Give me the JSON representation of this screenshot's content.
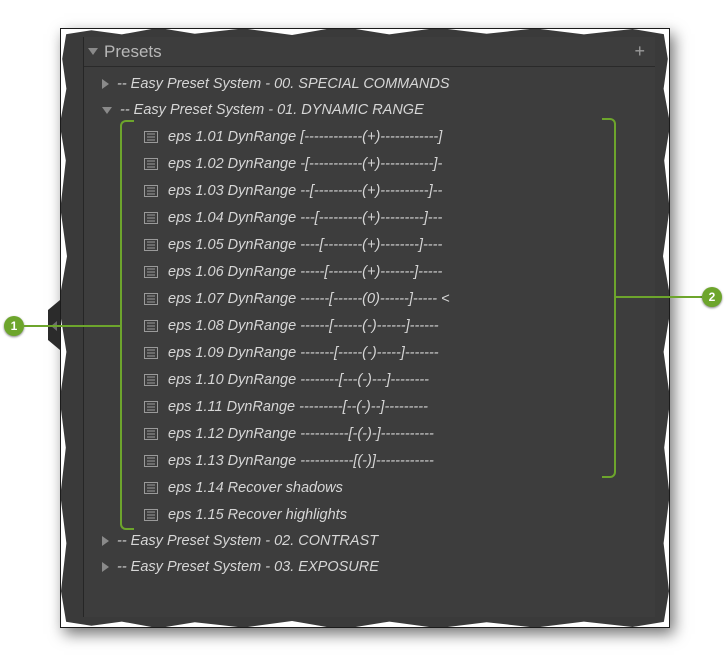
{
  "panel": {
    "title": "Presets",
    "add_label": "+"
  },
  "folders": [
    {
      "expanded": false,
      "label": "-- Easy Preset System - 00. SPECIAL COMMANDS"
    },
    {
      "expanded": true,
      "label": "-- Easy Preset System - 01. DYNAMIC RANGE"
    },
    {
      "expanded": false,
      "label": "-- Easy Preset System - 02. CONTRAST"
    },
    {
      "expanded": false,
      "label": "-- Easy Preset System - 03. EXPOSURE"
    }
  ],
  "presets_dynamic_range": [
    {
      "label": "eps 1.01 DynRange [------------(+)------------]"
    },
    {
      "label": "eps 1.02 DynRange -[-----------(+)-----------]-"
    },
    {
      "label": "eps 1.03 DynRange --[----------(+)----------]--"
    },
    {
      "label": "eps 1.04 DynRange ---[---------(+)---------]---"
    },
    {
      "label": "eps 1.05 DynRange ----[--------(+)--------]----"
    },
    {
      "label": "eps 1.06 DynRange -----[-------(+)-------]-----"
    },
    {
      "label": "eps 1.07 DynRange ------[------(0)------]----- <"
    },
    {
      "label": "eps 1.08 DynRange ------[------(-)------]------"
    },
    {
      "label": "eps 1.09 DynRange -------[-----(-)-----]-------"
    },
    {
      "label": "eps 1.10 DynRange --------[---(-)---]--------"
    },
    {
      "label": "eps 1.11 DynRange ---------[--(-)--]---------"
    },
    {
      "label": "eps 1.12 DynRange ----------[-(-)-]-----------"
    },
    {
      "label": "eps 1.13 DynRange -----------[(-)]------------"
    },
    {
      "label": "eps 1.14 Recover shadows"
    },
    {
      "label": "eps 1.15 Recover highlights"
    }
  ],
  "callouts": {
    "left": "1",
    "right": "2"
  },
  "colors": {
    "accent": "#6da52c",
    "panel_bg": "#3d3d3d",
    "text": "#d6d6d6"
  }
}
